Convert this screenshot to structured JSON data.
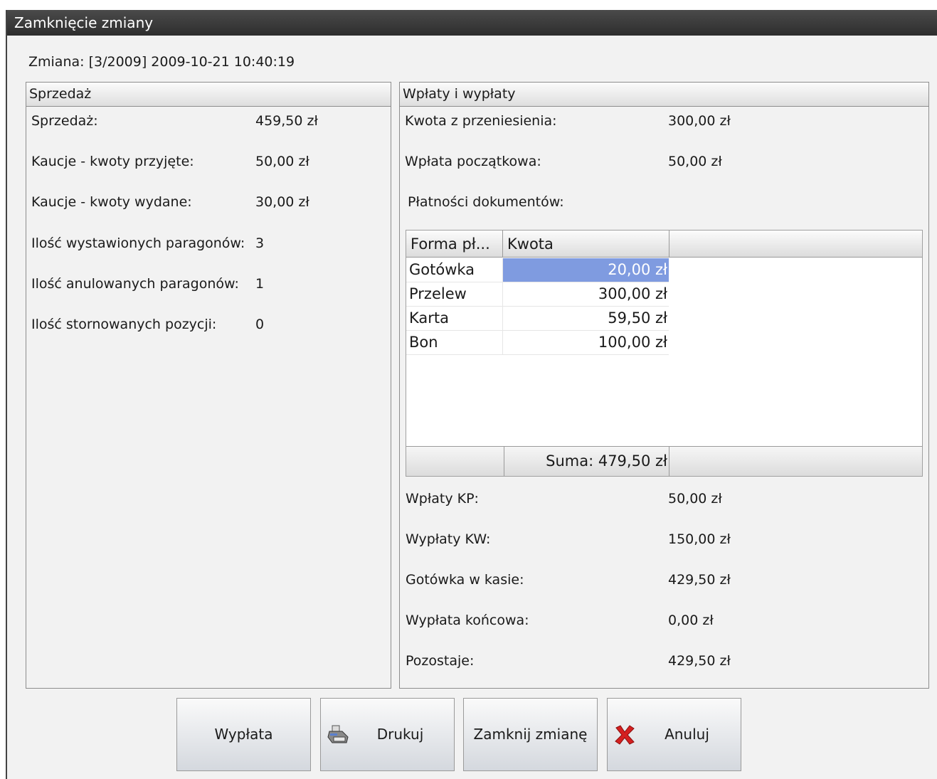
{
  "window": {
    "title": "Zamknięcie zmiany"
  },
  "shift": {
    "label": "Zmiana: [3/2009] 2009-10-21 10:40:19"
  },
  "sales": {
    "header": "Sprzedaż",
    "rows": [
      {
        "label": "Sprzedaż:",
        "value": "459,50 zł"
      },
      {
        "label": "Kaucje - kwoty przyjęte:",
        "value": "50,00 zł"
      },
      {
        "label": "Kaucje - kwoty wydane:",
        "value": "30,00 zł"
      },
      {
        "label": "Ilość wystawionych paragonów:",
        "value": "3"
      },
      {
        "label": "Ilość anulowanych paragonów:",
        "value": "1"
      },
      {
        "label": "Ilość stornowanych pozycji:",
        "value": "0"
      }
    ]
  },
  "payments": {
    "header": "Wpłaty i wypłaty",
    "top_rows": [
      {
        "label": "Kwota z przeniesienia:",
        "value": "300,00 zł"
      },
      {
        "label": "Wpłata początkowa:",
        "value": "50,00 zł"
      }
    ],
    "documents_label": "Płatności dokumentów:",
    "table": {
      "columns": [
        "Forma pł...",
        "Kwota"
      ],
      "rows": [
        {
          "method": "Gotówka",
          "amount": "20,00 zł"
        },
        {
          "method": "Przelew",
          "amount": "300,00 zł"
        },
        {
          "method": "Karta",
          "amount": "59,50 zł"
        },
        {
          "method": "Bon",
          "amount": "100,00 zł"
        }
      ],
      "footer": "Suma: 479,50 zł"
    },
    "bottom_rows": [
      {
        "label": "Wpłaty KP:",
        "value": "50,00 zł"
      },
      {
        "label": "Wypłaty KW:",
        "value": "150,00 zł"
      },
      {
        "label": "Gotówka w kasie:",
        "value": "429,50 zł"
      },
      {
        "label": "Wypłata końcowa:",
        "value": "0,00 zł"
      },
      {
        "label": "Pozostaje:",
        "value": "429,50 zł"
      }
    ]
  },
  "buttons": {
    "withdraw": "Wypłata",
    "print": "Drukuj",
    "close_shift": "Zamknij zmianę",
    "cancel": "Anuluj"
  },
  "icons": {
    "print": "printer-icon",
    "cancel": "red-x-icon"
  },
  "colors": {
    "selection": "#7f9be0",
    "titlebar": "#3a3a3a",
    "cancel_icon": "#d42020"
  }
}
